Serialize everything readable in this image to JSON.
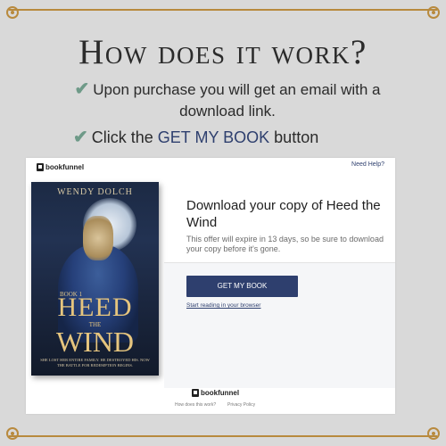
{
  "headline": "How does it work?",
  "bullets": [
    {
      "text": "Upon purchase you will get an email with a download link."
    },
    {
      "prefix": "Click the ",
      "accent": "GET MY BOOK",
      "suffix": " button"
    }
  ],
  "icons": {
    "check": "check-icon",
    "corner": "ornament-icon",
    "logo": "bookfunnel-logo-icon"
  },
  "colors": {
    "accent": "#2e3f6e",
    "check": "#6e9a88",
    "frame": "#b88a3e",
    "background": "#d9d9d9"
  },
  "bookfunnel": {
    "logo_text": "bookfunnel",
    "need_help": "Need Help?",
    "cover": {
      "author": "WENDY DOLCH",
      "book_label": "BOOK 1",
      "title_line1": "HEED",
      "title_line2": "THE",
      "title_line3": "WIND",
      "blurb": "SHE LOST HER ENTIRE FAMILY. HE DESTROYED HIS. NOW THE BATTLE FOR REDEMPTION BEGINS."
    },
    "download_title": "Download your copy of Heed the Wind",
    "download_subtitle": "This offer will expire in 13 days, so be sure to download your copy before it's gone.",
    "get_button": "GET MY BOOK",
    "read_link": "Start reading in your browser",
    "footer_logo": "bookfunnel",
    "footer_links": [
      "How does this work?",
      "Privacy Policy"
    ]
  }
}
